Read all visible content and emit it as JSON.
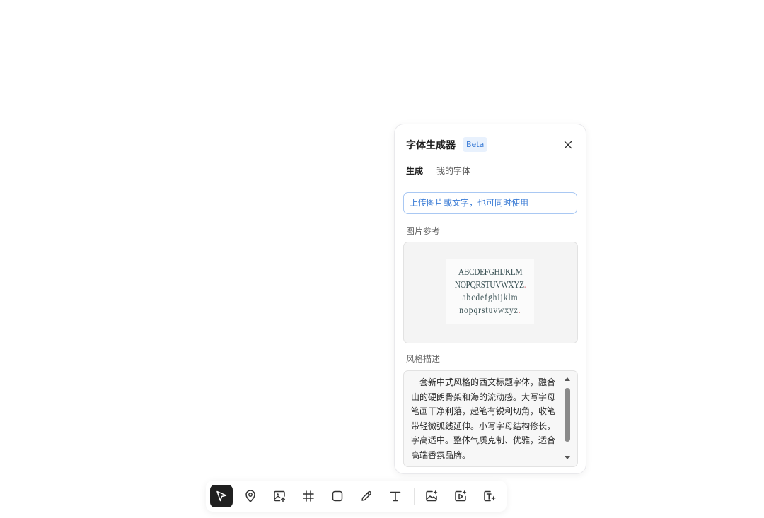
{
  "panel": {
    "title": "字体生成器",
    "badge": "Beta",
    "tabs": [
      {
        "label": "生成",
        "active": true
      },
      {
        "label": "我的字体",
        "active": false
      }
    ],
    "info_text": "上传图片或文字，也可同时使用",
    "image_ref_label": "图片参考",
    "image_sample": {
      "lines": [
        "ABCDEFGHIJKLM",
        "NOPQRSTUVWXYZ",
        "abcdefghijklm",
        "nopqrstuvwxyz"
      ],
      "dot": "."
    },
    "style_label": "风格描述",
    "style_text": "一套新中式风格的西文标题字体，融合山的硬朗骨架和海的流动感。大写字母笔画干净利落，起笔有锐利切角，收笔带轻微弧线延伸。小写字母结构修长，字高适中。整体气质克制、优雅，适合高端香氛品牌。"
  },
  "toolbar": {
    "tools": [
      {
        "name": "select",
        "icon": "cursor-icon",
        "active": true
      },
      {
        "name": "pin",
        "icon": "location-pin-icon"
      },
      {
        "name": "upload-image",
        "icon": "image-upload-icon"
      },
      {
        "name": "frame",
        "icon": "hash-frame-icon"
      },
      {
        "name": "rectangle",
        "icon": "square-icon"
      },
      {
        "name": "pen",
        "icon": "pencil-icon"
      },
      {
        "name": "text",
        "icon": "text-icon"
      },
      {
        "name": "ai-image",
        "icon": "ai-image-icon"
      },
      {
        "name": "ai-video",
        "icon": "ai-video-icon"
      },
      {
        "name": "ai-text",
        "icon": "ai-text-icon"
      }
    ]
  },
  "colors": {
    "accent": "#3a7bd5",
    "accent_bg": "#e8f1fd",
    "active_tool": "#202020"
  }
}
